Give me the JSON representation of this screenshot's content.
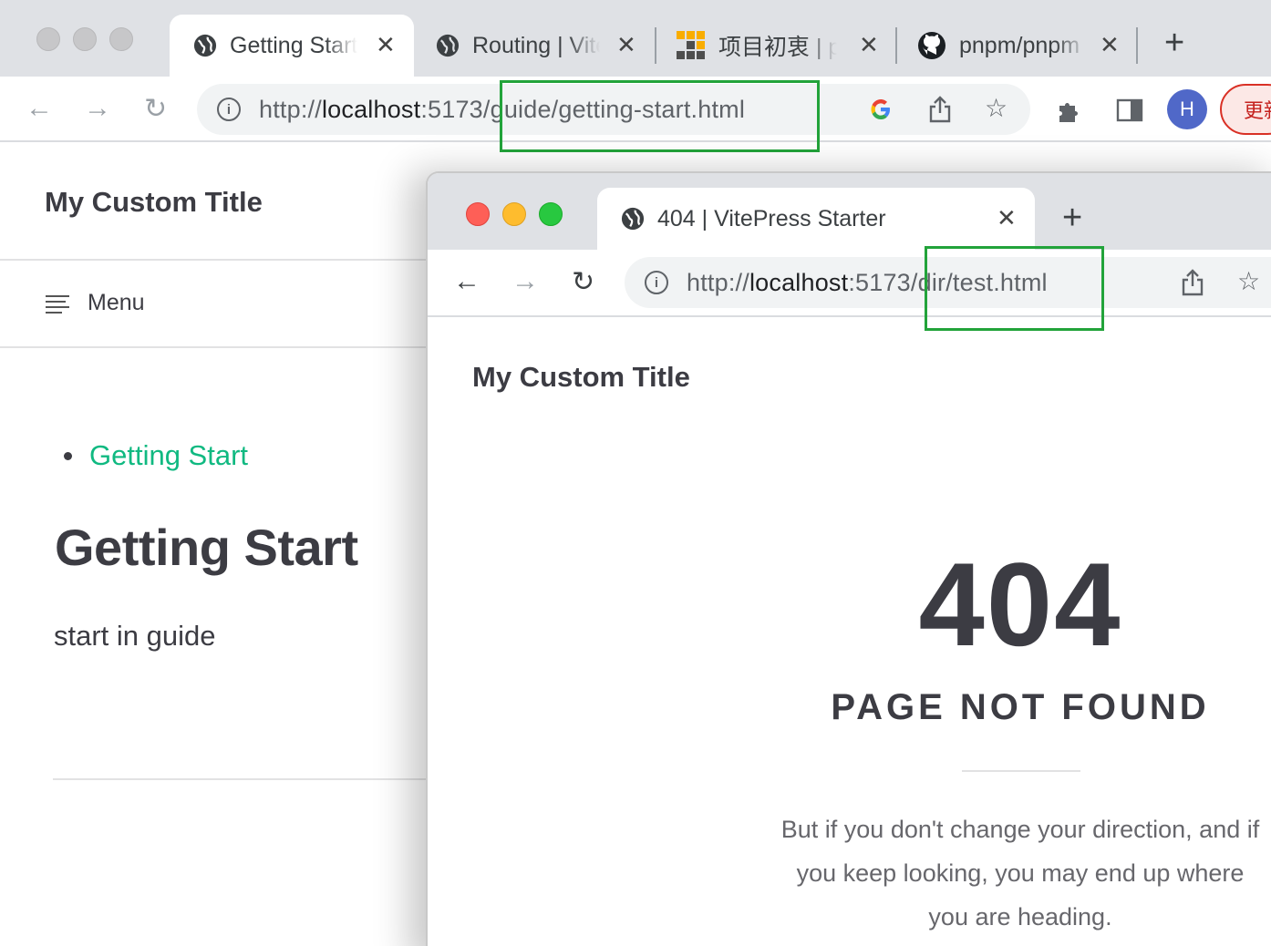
{
  "back_window": {
    "tabs": [
      {
        "title": "Getting Start",
        "icon": "globe-icon"
      },
      {
        "title": "Routing | VitePress",
        "icon": "globe-icon"
      },
      {
        "title": "项目初衷 | pnpm",
        "icon": "pnpm-logo-icon"
      },
      {
        "title": "pnpm/pnpm",
        "icon": "github-icon"
      }
    ],
    "close_glyph": "✕",
    "new_tab_glyph": "+",
    "url": {
      "scheme": "http://",
      "host": "localhost",
      "port": ":5173",
      "path": "/guide/getting-start.html"
    },
    "avatar_letter": "H",
    "update_label": "更新",
    "page": {
      "site_title": "My Custom Title",
      "menu_label": "Menu",
      "toc_link": "Getting Start",
      "heading": "Getting Start",
      "paragraph": "start in guide"
    }
  },
  "front_window": {
    "tab": {
      "title": "404 | VitePress Starter",
      "icon": "globe-icon"
    },
    "close_glyph": "✕",
    "new_tab_glyph": "+",
    "url": {
      "scheme": "http://",
      "host": "localhost",
      "port": ":5173",
      "path": "/dir/test.html"
    },
    "page": {
      "site_title": "My Custom Title",
      "code": "404",
      "title": "PAGE NOT FOUND",
      "quote": "But if you don't change your direction, and if you keep looking, you may end up where you are heading."
    }
  },
  "colors": {
    "brand": "#10b981",
    "highlight": "#22a33a",
    "avatar": "#5068c8"
  }
}
